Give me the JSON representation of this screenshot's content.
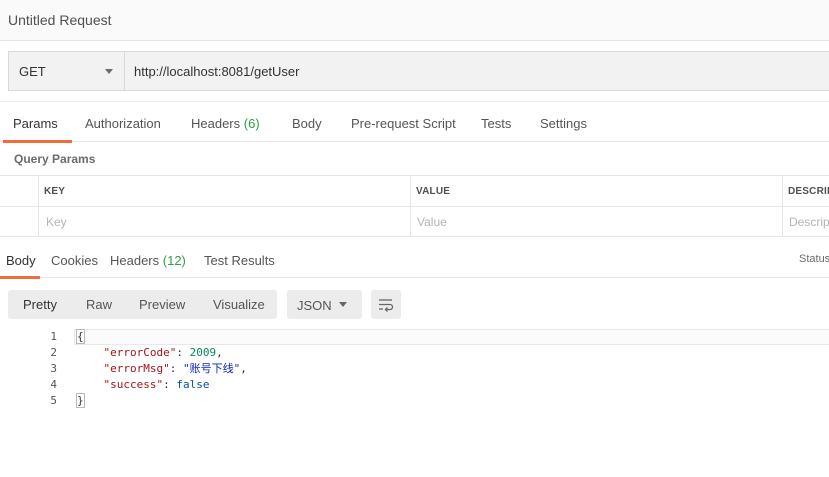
{
  "request": {
    "title": "Untitled Request",
    "method": "GET",
    "url": "http://localhost:8081/getUser"
  },
  "request_tabs": [
    {
      "label": "Params",
      "count": ""
    },
    {
      "label": "Authorization",
      "count": ""
    },
    {
      "label": "Headers",
      "count": "(6)"
    },
    {
      "label": "Body",
      "count": ""
    },
    {
      "label": "Pre-request Script",
      "count": ""
    },
    {
      "label": "Tests",
      "count": ""
    },
    {
      "label": "Settings",
      "count": ""
    }
  ],
  "params": {
    "section_title": "Query Params",
    "columns": [
      "KEY",
      "VALUE",
      "DESCRIPTION"
    ],
    "placeholders": {
      "key": "Key",
      "value": "Value",
      "description": "Description"
    }
  },
  "response_tabs": [
    {
      "label": "Body",
      "count": ""
    },
    {
      "label": "Cookies",
      "count": ""
    },
    {
      "label": "Headers",
      "count": "(12)"
    },
    {
      "label": "Test Results",
      "count": ""
    }
  ],
  "status_label": "Status",
  "view_modes": [
    "Pretty",
    "Raw",
    "Preview",
    "Visualize"
  ],
  "format": "JSON",
  "response_body": {
    "line_numbers": [
      "1",
      "2",
      "3",
      "4",
      "5"
    ],
    "open_brace": "{",
    "close_brace": "}",
    "fields": [
      {
        "key": "\"errorCode\"",
        "value": "2009",
        "kind": "number",
        "sep": ","
      },
      {
        "key": "\"errorMsg\"",
        "value": "\"账号下线\"",
        "kind": "string",
        "sep": ","
      },
      {
        "key": "\"success\"",
        "value": "false",
        "kind": "boolean",
        "sep": ""
      }
    ]
  },
  "colors": {
    "accent": "#f26b3a",
    "count": "#2f9e44",
    "json_key": "#a31515",
    "json_number": "#098658",
    "json_string": "#0b24c9",
    "json_boolean": "#0451a5"
  },
  "icons": {
    "method_dropdown": "chevron-down-icon",
    "format_dropdown": "chevron-down-icon",
    "wrap": "wrap-lines-icon"
  }
}
